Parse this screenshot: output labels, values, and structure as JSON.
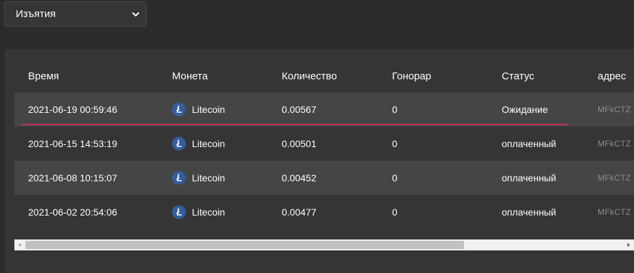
{
  "filter": {
    "selected": "Изъятия"
  },
  "table": {
    "headers": {
      "time": "Время",
      "coin": "Монета",
      "quantity": "Количество",
      "fee": "Гонорар",
      "status": "Статус",
      "address": "адрес"
    },
    "rows": [
      {
        "time": "2021-06-19 00:59:46",
        "coin": "Litecoin",
        "quantity": "0.00567",
        "fee": "0",
        "status": "Ожидание",
        "address": "MFkCTZ"
      },
      {
        "time": "2021-06-15 14:53:19",
        "coin": "Litecoin",
        "quantity": "0.00501",
        "fee": "0",
        "status": "оплаченный",
        "address": "MFkCTZ"
      },
      {
        "time": "2021-06-08 10:15:07",
        "coin": "Litecoin",
        "quantity": "0.00452",
        "fee": "0",
        "status": "оплаченный",
        "address": "MFkCTZ"
      },
      {
        "time": "2021-06-02 20:54:06",
        "coin": "Litecoin",
        "quantity": "0.00477",
        "fee": "0",
        "status": "оплаченный",
        "address": "MFkCTZ"
      }
    ]
  },
  "icons": {
    "coin": "litecoin-icon",
    "dropdown": "chevron-down-icon"
  },
  "colors": {
    "background": "#2b2b2b",
    "panel": "#353535",
    "row_alt": "#454545",
    "highlight_underline": "#c8325c",
    "litecoin": "#345d9d"
  },
  "scroll": {
    "horizontal_position": 0
  }
}
